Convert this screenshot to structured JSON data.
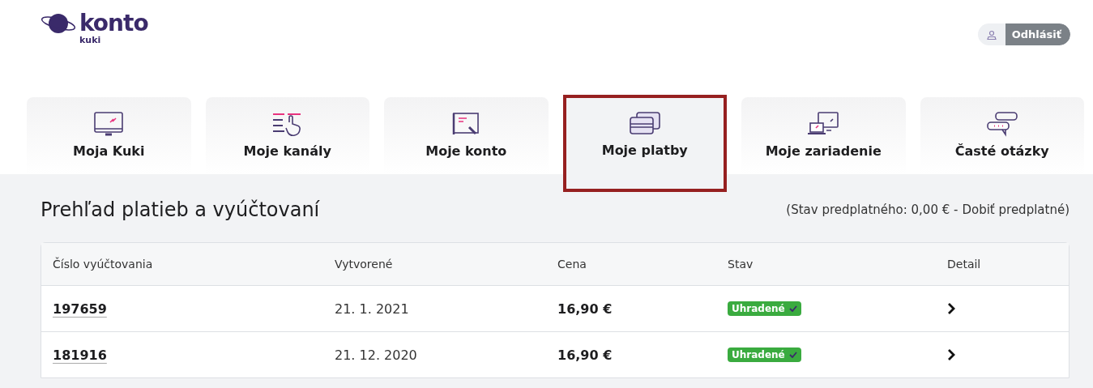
{
  "logo": {
    "title": "konto",
    "subtitle": "kuki"
  },
  "logout": {
    "label": "Odhlásiť"
  },
  "tabs": [
    {
      "label": "Moja Kuki",
      "kind": "monitor",
      "selected": false
    },
    {
      "label": "Moje kanály",
      "kind": "channels",
      "selected": false
    },
    {
      "label": "Moje konto",
      "kind": "document",
      "selected": false
    },
    {
      "label": "Moje platby",
      "kind": "cards",
      "selected": true
    },
    {
      "label": "Moje zariadenie",
      "kind": "devices",
      "selected": false
    },
    {
      "label": "Časté otázky",
      "kind": "chat",
      "selected": false
    }
  ],
  "section": {
    "title": "Prehľad platieb a vyúčtovaní",
    "balance_prefix": "(Stav predplatného: 0,00 € -",
    "balance_link": "Dobiť predplatné",
    "balance_suffix": ")"
  },
  "table": {
    "columns": [
      "Číslo vyúčtovania",
      "Vytvorené",
      "Cena",
      "Stav",
      "Detail"
    ],
    "rows": [
      {
        "number": "197659",
        "created": "21. 1. 2021",
        "price": "16,90 €",
        "status": "Uhradené",
        "paid": true
      },
      {
        "number": "181916",
        "created": "21. 12. 2020",
        "price": "16,90 €",
        "status": "Uhradené",
        "paid": true
      }
    ]
  }
}
